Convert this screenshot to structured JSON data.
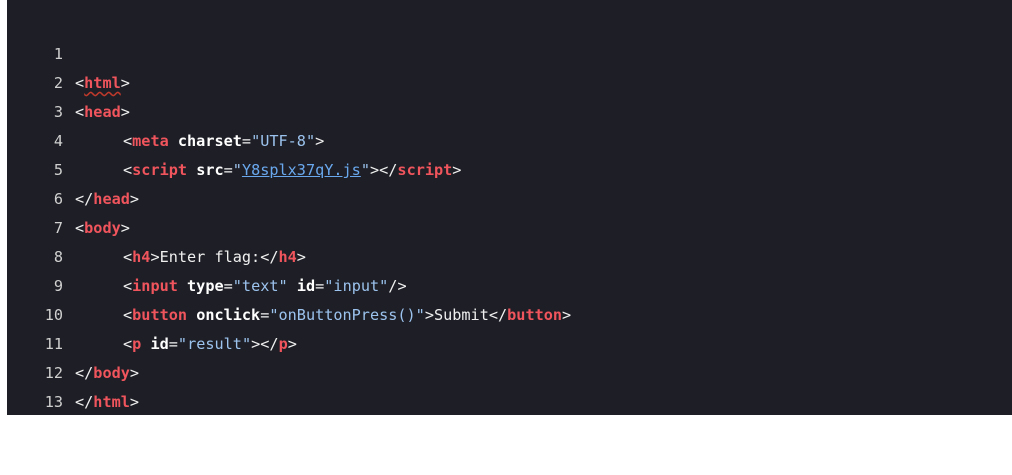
{
  "lines": {
    "n1": "1",
    "n2": "2",
    "n3": "3",
    "n4": "4",
    "n5": "5",
    "n6": "6",
    "n7": "7",
    "n8": "8",
    "n9": "9",
    "n10": "10",
    "n11": "11",
    "n12": "12",
    "n13": "13"
  },
  "code": {
    "lt": "<",
    "gt": ">",
    "close_lt": "</",
    "self_close": "/>",
    "eq": "=",
    "q": "\"",
    "html": "html",
    "head": "head",
    "meta": "meta",
    "charset_attr": "charset",
    "charset_val": "UTF-8",
    "script": "script",
    "src_attr": "src",
    "src_val": "Y8splx37qY.js",
    "body": "body",
    "h4": "h4",
    "h4_text": "Enter flag:",
    "input": "input",
    "type_attr": "type",
    "type_val": "text",
    "id_attr": "id",
    "input_id_val": "input",
    "button": "button",
    "onclick_attr": "onclick",
    "onclick_val": "onButtonPress()",
    "button_text": "Submit",
    "p": "p",
    "p_id_val": "result"
  },
  "colors": {
    "background": "#1e1f26",
    "tag": "#f0545c",
    "string": "#9cc3ee",
    "link": "#6aa8ee"
  }
}
